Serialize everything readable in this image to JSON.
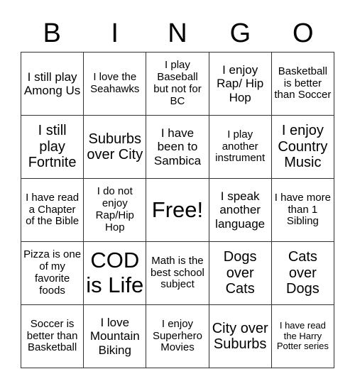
{
  "header": {
    "letters": [
      "B",
      "I",
      "N",
      "G",
      "O"
    ]
  },
  "card": {
    "rows": [
      [
        {
          "text": "I still play Among Us",
          "size": "s-m"
        },
        {
          "text": "I love the Seahawks",
          "size": "s-s"
        },
        {
          "text": "I play Baseball but not for BC",
          "size": "s-s"
        },
        {
          "text": "I enjoy Rap/ Hip Hop",
          "size": "s-m"
        },
        {
          "text": "Basketball is better than Soccer",
          "size": "s-s"
        }
      ],
      [
        {
          "text": "I still play Fortnite",
          "size": "s-l"
        },
        {
          "text": "Suburbs over City",
          "size": "s-l"
        },
        {
          "text": "I have been to Sambica",
          "size": "s-m"
        },
        {
          "text": "I play another instrument",
          "size": "s-s"
        },
        {
          "text": "I enjoy Country Music",
          "size": "s-l"
        }
      ],
      [
        {
          "text": "I have read a Chapter of the Bible",
          "size": "s-s"
        },
        {
          "text": "I do not enjoy Rap/Hip Hop",
          "size": "s-s"
        },
        {
          "text": "Free!",
          "size": "s-xl"
        },
        {
          "text": "I speak another language",
          "size": "s-m"
        },
        {
          "text": "I have more than 1 Sibling",
          "size": "s-s"
        }
      ],
      [
        {
          "text": "Pizza is one of my favorite foods",
          "size": "s-s"
        },
        {
          "text": "COD is Life",
          "size": "s-xl"
        },
        {
          "text": "Math is the best school subject",
          "size": "s-s"
        },
        {
          "text": "Dogs over Cats",
          "size": "s-l"
        },
        {
          "text": "Cats over Dogs",
          "size": "s-l"
        }
      ],
      [
        {
          "text": "Soccer is better than Basketball",
          "size": "s-s"
        },
        {
          "text": "I love Mountain Biking",
          "size": "s-m"
        },
        {
          "text": "I enjoy Superhero Movies",
          "size": "s-s"
        },
        {
          "text": "City over Suburbs",
          "size": "s-l"
        },
        {
          "text": "I have read the Harry Potter series",
          "size": "s-xxs"
        }
      ]
    ]
  }
}
